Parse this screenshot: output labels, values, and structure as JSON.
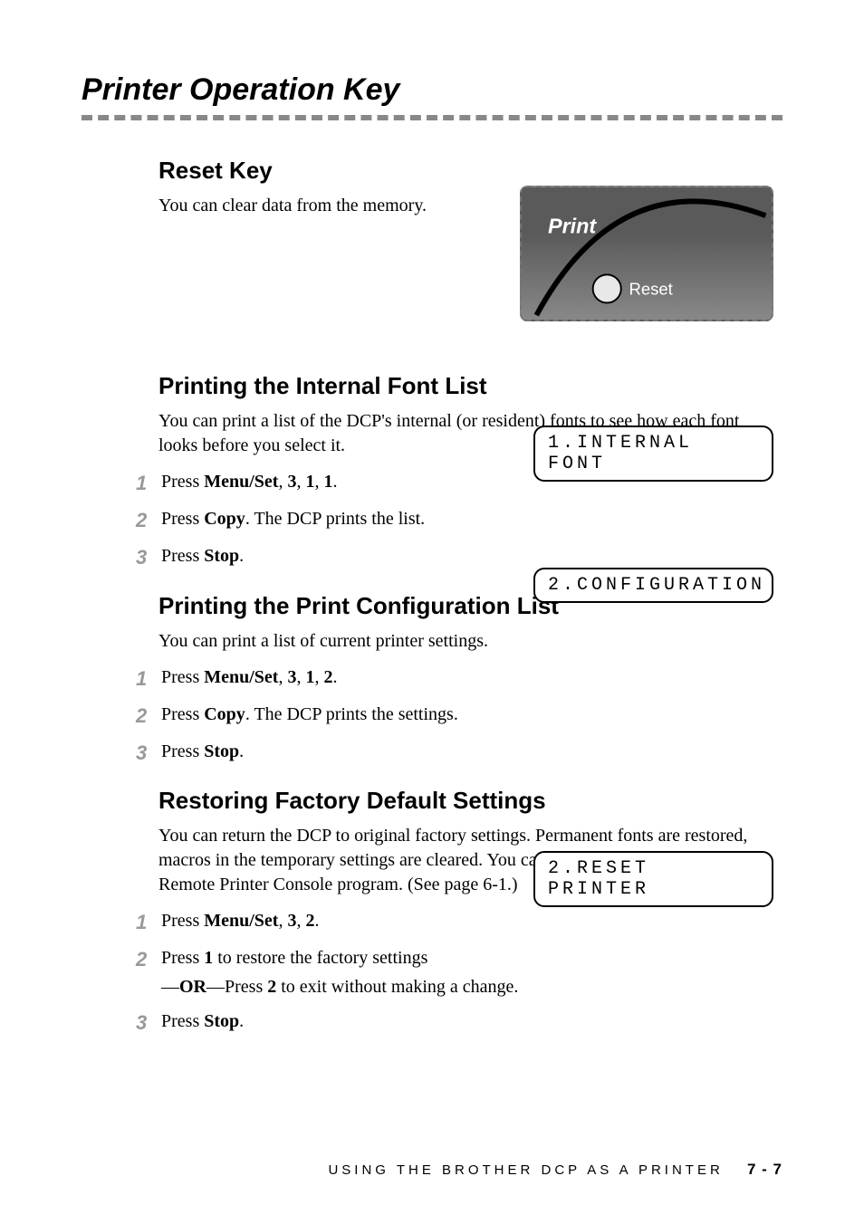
{
  "main_title": "Printer Operation Key",
  "reset_key": {
    "heading": "Reset Key",
    "text": "You can clear data from the memory."
  },
  "print_panel": {
    "print_label": "Print",
    "reset_label": "Reset"
  },
  "internal_font": {
    "heading": "Printing the Internal Font List",
    "intro": "You can print a list of the DCP's internal (or resident) fonts to see how each font looks before you select it.",
    "steps": [
      {
        "pre": "Press ",
        "bold": "Menu/Set",
        "post1": ", ",
        "bold2": "3",
        "post2": ", ",
        "bold3": "1",
        "post3": ", ",
        "bold4": "1",
        "post4": "."
      },
      {
        "pre": "Press ",
        "bold": "Copy",
        "post": ". The DCP prints the list."
      },
      {
        "pre": "Press ",
        "bold": "Stop",
        "post": "."
      }
    ],
    "lcd": "1.INTERNAL FONT"
  },
  "config_list": {
    "heading": "Printing the Print Configuration List",
    "intro": "You can print a list of current printer settings.",
    "steps": [
      {
        "pre": "Press ",
        "bold": "Menu/Set",
        "post1": ", ",
        "bold2": "3",
        "post2": ", ",
        "bold3": "1",
        "post3": ", ",
        "bold4": "2",
        "post4": "."
      },
      {
        "pre": "Press ",
        "bold": "Copy",
        "post": ". The DCP prints the settings."
      },
      {
        "pre": "Press ",
        "bold": "Stop",
        "post": "."
      }
    ],
    "lcd": "2.CONFIGURATION"
  },
  "factory_reset": {
    "heading": "Restoring Factory Default Settings",
    "intro": "You can return the DCP to original factory settings.  Permanent fonts are restored, macros in the temporary settings are cleared.  You can change user settings using the Remote Printer Console program. (See page 6-1.)",
    "steps": [
      {
        "pre": "Press ",
        "bold": "Menu/Set",
        "post1": ", ",
        "bold2": "3",
        "post2": ", ",
        "bold3": "2",
        "post3": "."
      },
      {
        "line1_pre": "Press ",
        "line1_bold": "1",
        "line1_post": " to restore the factory settings",
        "line2_pre": "—",
        "line2_bold1": "OR",
        "line2_mid": "—Press ",
        "line2_bold2": "2",
        "line2_post": " to exit without making a change."
      },
      {
        "pre": "Press ",
        "bold": "Stop",
        "post": "."
      }
    ],
    "lcd": "2.RESET PRINTER"
  },
  "footer": {
    "text": "USING THE BROTHER DCP AS A PRINTER",
    "page": "7 - 7"
  }
}
